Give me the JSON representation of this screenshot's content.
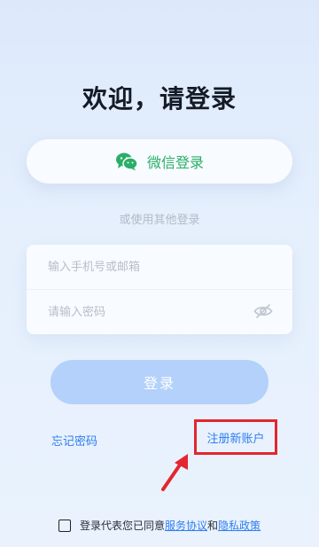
{
  "title": "欢迎，请登录",
  "wechat_login": {
    "label": "微信登录",
    "icon": "wechat-icon",
    "color": "#2aae67"
  },
  "or_text": "或使用其他登录",
  "form": {
    "phone_placeholder": "输入手机号或邮箱",
    "password_placeholder": "请输入密码",
    "toggle_icon": "eye-off-icon"
  },
  "login_button": "登录",
  "forgot_password": "忘记密码",
  "register": "注册新账户",
  "agreement": {
    "prefix": "登录代表您已同意",
    "terms": "服务协议",
    "and": "和",
    "privacy": "隐私政策"
  },
  "colors": {
    "accent": "#2f7ef0",
    "login_button": "#b3d1fa",
    "highlight": "#e3262f"
  }
}
